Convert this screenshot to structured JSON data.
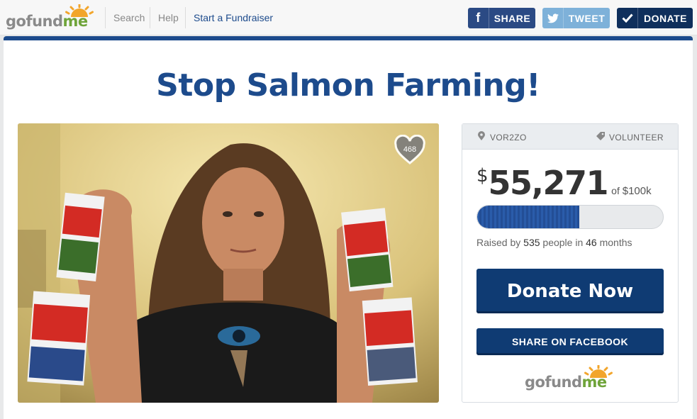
{
  "brand": {
    "go": "go",
    "fund": "fund",
    "me": "me"
  },
  "nav": {
    "links": [
      "Search",
      "Help",
      "Start a Fundraiser"
    ]
  },
  "top_buttons": {
    "share": {
      "icon": "facebook-icon",
      "label": "SHARE"
    },
    "tweet": {
      "icon": "twitter-icon",
      "label": "TWEET"
    },
    "donate": {
      "icon": "checkmark-icon",
      "label": "DONATE"
    }
  },
  "campaign": {
    "title": "Stop Salmon Farming!",
    "likes": "468",
    "location": "VOR2ZO",
    "category": "VOLUNTEER",
    "currency": "$",
    "raised": "55,271",
    "goal_prefix": "of",
    "goal": "$100k",
    "progress_fraction": 0.55,
    "raised_by_prefix": "Raised by",
    "people": "535",
    "people_suffix": "people in",
    "months": "46",
    "months_suffix": "months",
    "donate_now": "Donate Now",
    "share_facebook": "SHARE ON FACEBOOK"
  },
  "colors": {
    "brand_blue": "#1d4b8c",
    "dark_blue": "#0f3b73",
    "tweet_blue": "#7eb1d9",
    "brand_green": "#6fa43a",
    "brand_orange": "#f2a52b"
  }
}
